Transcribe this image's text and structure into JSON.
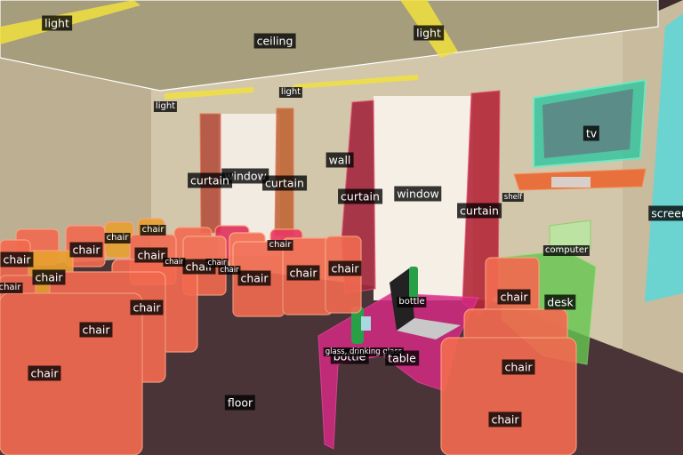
{
  "labels": {
    "light_1": "light",
    "light_2": "light",
    "light_3": "light",
    "light_4": "light",
    "ceiling": "ceiling",
    "wall": "wall",
    "tv": "tv",
    "shelf": "shelf",
    "screen": "screen",
    "curtain_1": "curtain",
    "curtain_2": "curtain",
    "curtain_3": "curtain",
    "curtain_4": "curtain",
    "window_1": "window",
    "window_2": "window",
    "computer": "computer",
    "desk": "desk",
    "bottle_1": "bottle",
    "bottle_2": "bottle",
    "glass": "glass, drinking glass",
    "table": "table",
    "floor": "floor",
    "chair": "chair"
  },
  "colors": {
    "ceiling": "#b8ae8a",
    "wall": "#cfc2a6",
    "floor": "#4a3338",
    "chair_mask": "#f26a50",
    "curtain_mask": "#c8323c",
    "tv_mask": "#2fc6a0",
    "desk_mask": "#64c850",
    "table_mask": "#d42a82",
    "light_mask": "#f0e040",
    "screen_mask": "#5ad8d8"
  }
}
